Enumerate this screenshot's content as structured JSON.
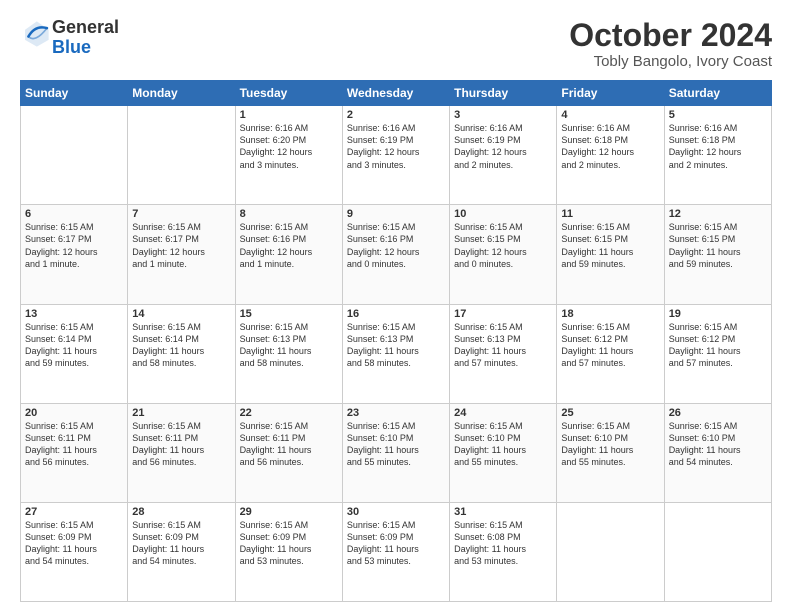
{
  "header": {
    "logo_line1": "General",
    "logo_line2": "Blue",
    "title": "October 2024",
    "subtitle": "Tobly Bangolo, Ivory Coast"
  },
  "days_of_week": [
    "Sunday",
    "Monday",
    "Tuesday",
    "Wednesday",
    "Thursday",
    "Friday",
    "Saturday"
  ],
  "weeks": [
    [
      {
        "day": "",
        "info": ""
      },
      {
        "day": "",
        "info": ""
      },
      {
        "day": "1",
        "info": "Sunrise: 6:16 AM\nSunset: 6:20 PM\nDaylight: 12 hours\nand 3 minutes."
      },
      {
        "day": "2",
        "info": "Sunrise: 6:16 AM\nSunset: 6:19 PM\nDaylight: 12 hours\nand 3 minutes."
      },
      {
        "day": "3",
        "info": "Sunrise: 6:16 AM\nSunset: 6:19 PM\nDaylight: 12 hours\nand 2 minutes."
      },
      {
        "day": "4",
        "info": "Sunrise: 6:16 AM\nSunset: 6:18 PM\nDaylight: 12 hours\nand 2 minutes."
      },
      {
        "day": "5",
        "info": "Sunrise: 6:16 AM\nSunset: 6:18 PM\nDaylight: 12 hours\nand 2 minutes."
      }
    ],
    [
      {
        "day": "6",
        "info": "Sunrise: 6:15 AM\nSunset: 6:17 PM\nDaylight: 12 hours\nand 1 minute."
      },
      {
        "day": "7",
        "info": "Sunrise: 6:15 AM\nSunset: 6:17 PM\nDaylight: 12 hours\nand 1 minute."
      },
      {
        "day": "8",
        "info": "Sunrise: 6:15 AM\nSunset: 6:16 PM\nDaylight: 12 hours\nand 1 minute."
      },
      {
        "day": "9",
        "info": "Sunrise: 6:15 AM\nSunset: 6:16 PM\nDaylight: 12 hours\nand 0 minutes."
      },
      {
        "day": "10",
        "info": "Sunrise: 6:15 AM\nSunset: 6:15 PM\nDaylight: 12 hours\nand 0 minutes."
      },
      {
        "day": "11",
        "info": "Sunrise: 6:15 AM\nSunset: 6:15 PM\nDaylight: 11 hours\nand 59 minutes."
      },
      {
        "day": "12",
        "info": "Sunrise: 6:15 AM\nSunset: 6:15 PM\nDaylight: 11 hours\nand 59 minutes."
      }
    ],
    [
      {
        "day": "13",
        "info": "Sunrise: 6:15 AM\nSunset: 6:14 PM\nDaylight: 11 hours\nand 59 minutes."
      },
      {
        "day": "14",
        "info": "Sunrise: 6:15 AM\nSunset: 6:14 PM\nDaylight: 11 hours\nand 58 minutes."
      },
      {
        "day": "15",
        "info": "Sunrise: 6:15 AM\nSunset: 6:13 PM\nDaylight: 11 hours\nand 58 minutes."
      },
      {
        "day": "16",
        "info": "Sunrise: 6:15 AM\nSunset: 6:13 PM\nDaylight: 11 hours\nand 58 minutes."
      },
      {
        "day": "17",
        "info": "Sunrise: 6:15 AM\nSunset: 6:13 PM\nDaylight: 11 hours\nand 57 minutes."
      },
      {
        "day": "18",
        "info": "Sunrise: 6:15 AM\nSunset: 6:12 PM\nDaylight: 11 hours\nand 57 minutes."
      },
      {
        "day": "19",
        "info": "Sunrise: 6:15 AM\nSunset: 6:12 PM\nDaylight: 11 hours\nand 57 minutes."
      }
    ],
    [
      {
        "day": "20",
        "info": "Sunrise: 6:15 AM\nSunset: 6:11 PM\nDaylight: 11 hours\nand 56 minutes."
      },
      {
        "day": "21",
        "info": "Sunrise: 6:15 AM\nSunset: 6:11 PM\nDaylight: 11 hours\nand 56 minutes."
      },
      {
        "day": "22",
        "info": "Sunrise: 6:15 AM\nSunset: 6:11 PM\nDaylight: 11 hours\nand 56 minutes."
      },
      {
        "day": "23",
        "info": "Sunrise: 6:15 AM\nSunset: 6:10 PM\nDaylight: 11 hours\nand 55 minutes."
      },
      {
        "day": "24",
        "info": "Sunrise: 6:15 AM\nSunset: 6:10 PM\nDaylight: 11 hours\nand 55 minutes."
      },
      {
        "day": "25",
        "info": "Sunrise: 6:15 AM\nSunset: 6:10 PM\nDaylight: 11 hours\nand 55 minutes."
      },
      {
        "day": "26",
        "info": "Sunrise: 6:15 AM\nSunset: 6:10 PM\nDaylight: 11 hours\nand 54 minutes."
      }
    ],
    [
      {
        "day": "27",
        "info": "Sunrise: 6:15 AM\nSunset: 6:09 PM\nDaylight: 11 hours\nand 54 minutes."
      },
      {
        "day": "28",
        "info": "Sunrise: 6:15 AM\nSunset: 6:09 PM\nDaylight: 11 hours\nand 54 minutes."
      },
      {
        "day": "29",
        "info": "Sunrise: 6:15 AM\nSunset: 6:09 PM\nDaylight: 11 hours\nand 53 minutes."
      },
      {
        "day": "30",
        "info": "Sunrise: 6:15 AM\nSunset: 6:09 PM\nDaylight: 11 hours\nand 53 minutes."
      },
      {
        "day": "31",
        "info": "Sunrise: 6:15 AM\nSunset: 6:08 PM\nDaylight: 11 hours\nand 53 minutes."
      },
      {
        "day": "",
        "info": ""
      },
      {
        "day": "",
        "info": ""
      }
    ]
  ]
}
